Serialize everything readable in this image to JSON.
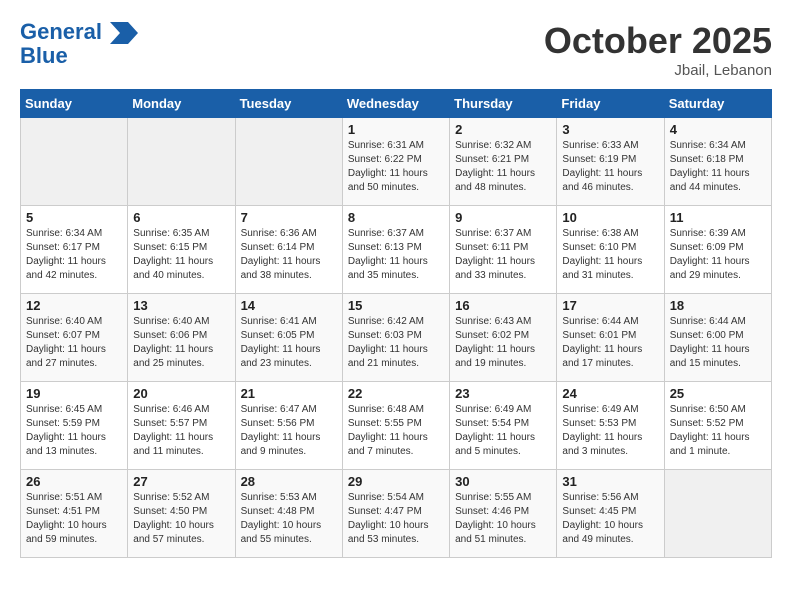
{
  "header": {
    "logo_line1": "General",
    "logo_line2": "Blue",
    "month": "October 2025",
    "location": "Jbail, Lebanon"
  },
  "days_of_week": [
    "Sunday",
    "Monday",
    "Tuesday",
    "Wednesday",
    "Thursday",
    "Friday",
    "Saturday"
  ],
  "weeks": [
    [
      {
        "num": "",
        "sunrise": "",
        "sunset": "",
        "daylight": ""
      },
      {
        "num": "",
        "sunrise": "",
        "sunset": "",
        "daylight": ""
      },
      {
        "num": "",
        "sunrise": "",
        "sunset": "",
        "daylight": ""
      },
      {
        "num": "1",
        "sunrise": "6:31 AM",
        "sunset": "6:22 PM",
        "daylight": "11 hours and 50 minutes."
      },
      {
        "num": "2",
        "sunrise": "6:32 AM",
        "sunset": "6:21 PM",
        "daylight": "11 hours and 48 minutes."
      },
      {
        "num": "3",
        "sunrise": "6:33 AM",
        "sunset": "6:19 PM",
        "daylight": "11 hours and 46 minutes."
      },
      {
        "num": "4",
        "sunrise": "6:34 AM",
        "sunset": "6:18 PM",
        "daylight": "11 hours and 44 minutes."
      }
    ],
    [
      {
        "num": "5",
        "sunrise": "6:34 AM",
        "sunset": "6:17 PM",
        "daylight": "11 hours and 42 minutes."
      },
      {
        "num": "6",
        "sunrise": "6:35 AM",
        "sunset": "6:15 PM",
        "daylight": "11 hours and 40 minutes."
      },
      {
        "num": "7",
        "sunrise": "6:36 AM",
        "sunset": "6:14 PM",
        "daylight": "11 hours and 38 minutes."
      },
      {
        "num": "8",
        "sunrise": "6:37 AM",
        "sunset": "6:13 PM",
        "daylight": "11 hours and 35 minutes."
      },
      {
        "num": "9",
        "sunrise": "6:37 AM",
        "sunset": "6:11 PM",
        "daylight": "11 hours and 33 minutes."
      },
      {
        "num": "10",
        "sunrise": "6:38 AM",
        "sunset": "6:10 PM",
        "daylight": "11 hours and 31 minutes."
      },
      {
        "num": "11",
        "sunrise": "6:39 AM",
        "sunset": "6:09 PM",
        "daylight": "11 hours and 29 minutes."
      }
    ],
    [
      {
        "num": "12",
        "sunrise": "6:40 AM",
        "sunset": "6:07 PM",
        "daylight": "11 hours and 27 minutes."
      },
      {
        "num": "13",
        "sunrise": "6:40 AM",
        "sunset": "6:06 PM",
        "daylight": "11 hours and 25 minutes."
      },
      {
        "num": "14",
        "sunrise": "6:41 AM",
        "sunset": "6:05 PM",
        "daylight": "11 hours and 23 minutes."
      },
      {
        "num": "15",
        "sunrise": "6:42 AM",
        "sunset": "6:03 PM",
        "daylight": "11 hours and 21 minutes."
      },
      {
        "num": "16",
        "sunrise": "6:43 AM",
        "sunset": "6:02 PM",
        "daylight": "11 hours and 19 minutes."
      },
      {
        "num": "17",
        "sunrise": "6:44 AM",
        "sunset": "6:01 PM",
        "daylight": "11 hours and 17 minutes."
      },
      {
        "num": "18",
        "sunrise": "6:44 AM",
        "sunset": "6:00 PM",
        "daylight": "11 hours and 15 minutes."
      }
    ],
    [
      {
        "num": "19",
        "sunrise": "6:45 AM",
        "sunset": "5:59 PM",
        "daylight": "11 hours and 13 minutes."
      },
      {
        "num": "20",
        "sunrise": "6:46 AM",
        "sunset": "5:57 PM",
        "daylight": "11 hours and 11 minutes."
      },
      {
        "num": "21",
        "sunrise": "6:47 AM",
        "sunset": "5:56 PM",
        "daylight": "11 hours and 9 minutes."
      },
      {
        "num": "22",
        "sunrise": "6:48 AM",
        "sunset": "5:55 PM",
        "daylight": "11 hours and 7 minutes."
      },
      {
        "num": "23",
        "sunrise": "6:49 AM",
        "sunset": "5:54 PM",
        "daylight": "11 hours and 5 minutes."
      },
      {
        "num": "24",
        "sunrise": "6:49 AM",
        "sunset": "5:53 PM",
        "daylight": "11 hours and 3 minutes."
      },
      {
        "num": "25",
        "sunrise": "6:50 AM",
        "sunset": "5:52 PM",
        "daylight": "11 hours and 1 minute."
      }
    ],
    [
      {
        "num": "26",
        "sunrise": "5:51 AM",
        "sunset": "4:51 PM",
        "daylight": "10 hours and 59 minutes."
      },
      {
        "num": "27",
        "sunrise": "5:52 AM",
        "sunset": "4:50 PM",
        "daylight": "10 hours and 57 minutes."
      },
      {
        "num": "28",
        "sunrise": "5:53 AM",
        "sunset": "4:48 PM",
        "daylight": "10 hours and 55 minutes."
      },
      {
        "num": "29",
        "sunrise": "5:54 AM",
        "sunset": "4:47 PM",
        "daylight": "10 hours and 53 minutes."
      },
      {
        "num": "30",
        "sunrise": "5:55 AM",
        "sunset": "4:46 PM",
        "daylight": "10 hours and 51 minutes."
      },
      {
        "num": "31",
        "sunrise": "5:56 AM",
        "sunset": "4:45 PM",
        "daylight": "10 hours and 49 minutes."
      },
      {
        "num": "",
        "sunrise": "",
        "sunset": "",
        "daylight": ""
      }
    ]
  ]
}
